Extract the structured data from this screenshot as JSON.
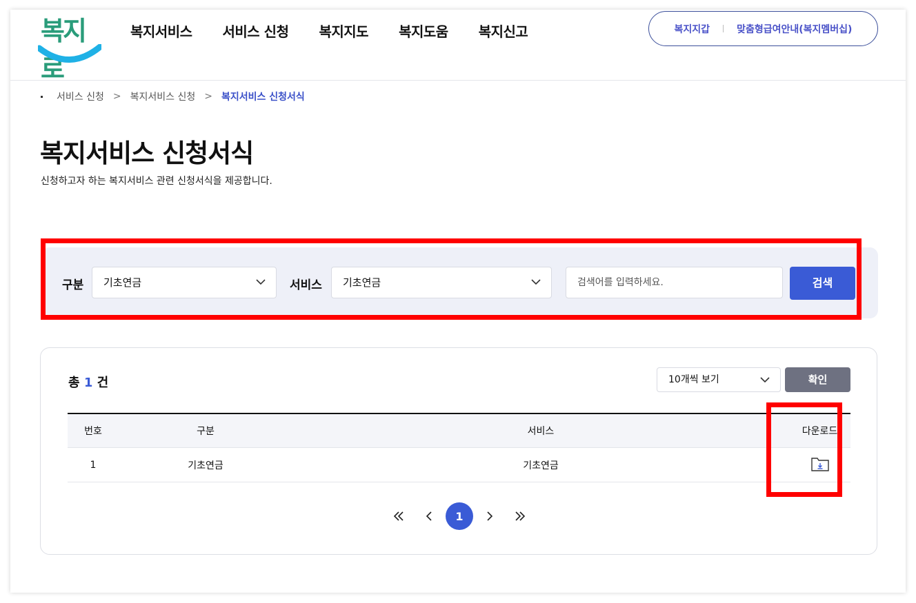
{
  "header": {
    "logo_text": "복지로",
    "nav": [
      "복지서비스",
      "서비스 신청",
      "복지지도",
      "복지도움",
      "복지신고"
    ],
    "util": [
      "복지지갑",
      "맞춤형급여안내(복지멤버십)"
    ]
  },
  "breadcrumb": [
    "서비스 신청",
    "복지서비스 신청",
    "복지서비스 신청서식"
  ],
  "page": {
    "title": "복지서비스 신청서식",
    "description": "신청하고자 하는 복지서비스 관련 신청서식을 제공합니다."
  },
  "search": {
    "category_label": "구분",
    "category_value": "기초연금",
    "service_label": "서비스",
    "service_value": "기초연금",
    "keyword_placeholder": "검색어를 입력하세요.",
    "search_button": "검색"
  },
  "list": {
    "total_prefix": "총",
    "total_count": "1",
    "total_suffix": "건",
    "per_page": "10개씩 보기",
    "confirm_button": "확인",
    "columns": [
      "번호",
      "구분",
      "서비스",
      "다운로드"
    ],
    "rows": [
      {
        "no": "1",
        "category": "기초연금",
        "service": "기초연금"
      }
    ]
  },
  "pagination": {
    "current": "1"
  },
  "colors": {
    "accent": "#3a5bd6",
    "highlight": "#ff0000",
    "search_bg": "#eef0f8"
  }
}
